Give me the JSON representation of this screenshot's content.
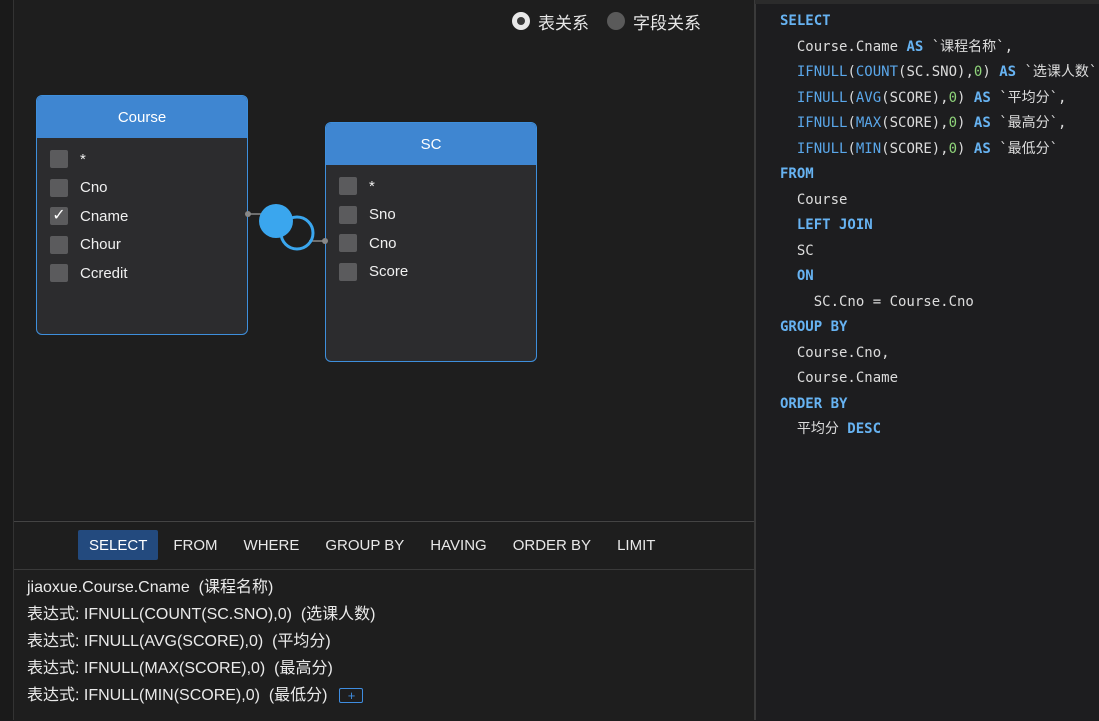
{
  "relation_toggle": {
    "options": [
      {
        "label": "表关系",
        "selected": true
      },
      {
        "label": "字段关系",
        "selected": false
      }
    ]
  },
  "tables": [
    {
      "name": "Course",
      "fields": [
        {
          "label": "*",
          "checked": false
        },
        {
          "label": "Cno",
          "checked": false
        },
        {
          "label": "Cname",
          "checked": true
        },
        {
          "label": "Chour",
          "checked": false
        },
        {
          "label": "Ccredit",
          "checked": false
        }
      ]
    },
    {
      "name": "SC",
      "fields": [
        {
          "label": "*",
          "checked": false
        },
        {
          "label": "Sno",
          "checked": false
        },
        {
          "label": "Cno",
          "checked": false
        },
        {
          "label": "Score",
          "checked": false
        }
      ]
    }
  ],
  "join": {
    "type": "left-join-icon"
  },
  "tabs": [
    "SELECT",
    "FROM",
    "WHERE",
    "GROUP BY",
    "HAVING",
    "ORDER BY",
    "LIMIT"
  ],
  "active_tab": "SELECT",
  "select_items": [
    {
      "prefix": "",
      "expr": "jiaoxue.Course.Cname",
      "alias": "(课程名称)"
    },
    {
      "prefix": "表达式: ",
      "expr": "IFNULL(COUNT(SC.SNO),0)",
      "alias": "(选课人数)"
    },
    {
      "prefix": "表达式: ",
      "expr": "IFNULL(AVG(SCORE),0)",
      "alias": "(平均分)"
    },
    {
      "prefix": "表达式: ",
      "expr": "IFNULL(MAX(SCORE),0)",
      "alias": "(最高分)"
    },
    {
      "prefix": "表达式: ",
      "expr": "IFNULL(MIN(SCORE),0)",
      "alias": "(最低分)"
    }
  ],
  "add_button_label": "+",
  "sql_lines": [
    [
      [
        "kw",
        "SELECT"
      ]
    ],
    [
      [
        "t",
        "  Course.Cname "
      ],
      [
        "kw",
        "AS"
      ],
      [
        "t",
        " `课程名称`,"
      ]
    ],
    [
      [
        "t",
        "  "
      ],
      [
        "fn",
        "IFNULL"
      ],
      [
        "t",
        "("
      ],
      [
        "fn",
        "COUNT"
      ],
      [
        "t",
        "(SC.SNO),"
      ],
      [
        "num",
        "0"
      ],
      [
        "t",
        ") "
      ],
      [
        "kw",
        "AS"
      ],
      [
        "t",
        " `选课人数`,"
      ]
    ],
    [
      [
        "t",
        "  "
      ],
      [
        "fn",
        "IFNULL"
      ],
      [
        "t",
        "("
      ],
      [
        "fn",
        "AVG"
      ],
      [
        "t",
        "(SCORE),"
      ],
      [
        "num",
        "0"
      ],
      [
        "t",
        ") "
      ],
      [
        "kw",
        "AS"
      ],
      [
        "t",
        " `平均分`,"
      ]
    ],
    [
      [
        "t",
        "  "
      ],
      [
        "fn",
        "IFNULL"
      ],
      [
        "t",
        "("
      ],
      [
        "fn",
        "MAX"
      ],
      [
        "t",
        "(SCORE),"
      ],
      [
        "num",
        "0"
      ],
      [
        "t",
        ") "
      ],
      [
        "kw",
        "AS"
      ],
      [
        "t",
        " `最高分`,"
      ]
    ],
    [
      [
        "t",
        "  "
      ],
      [
        "fn",
        "IFNULL"
      ],
      [
        "t",
        "("
      ],
      [
        "fn",
        "MIN"
      ],
      [
        "t",
        "(SCORE),"
      ],
      [
        "num",
        "0"
      ],
      [
        "t",
        ") "
      ],
      [
        "kw",
        "AS"
      ],
      [
        "t",
        " `最低分`"
      ]
    ],
    [
      [
        "kw",
        "FROM"
      ]
    ],
    [
      [
        "t",
        "  Course"
      ]
    ],
    [
      [
        "t",
        "  "
      ],
      [
        "kw",
        "LEFT JOIN"
      ]
    ],
    [
      [
        "t",
        "  SC"
      ]
    ],
    [
      [
        "t",
        "  "
      ],
      [
        "kw",
        "ON"
      ]
    ],
    [
      [
        "t",
        "    SC.Cno = Course.Cno"
      ]
    ],
    [
      [
        "kw",
        "GROUP BY"
      ]
    ],
    [
      [
        "t",
        "  Course.Cno,"
      ]
    ],
    [
      [
        "t",
        "  Course.Cname"
      ]
    ],
    [
      [
        "kw",
        "ORDER BY"
      ]
    ],
    [
      [
        "t",
        "  平均分 "
      ],
      [
        "kw",
        "DESC"
      ]
    ]
  ],
  "colors": {
    "accent": "#3f86d1",
    "active_tab": "#234a7e",
    "keyword": "#67b3f2",
    "number": "#8fd47a"
  }
}
